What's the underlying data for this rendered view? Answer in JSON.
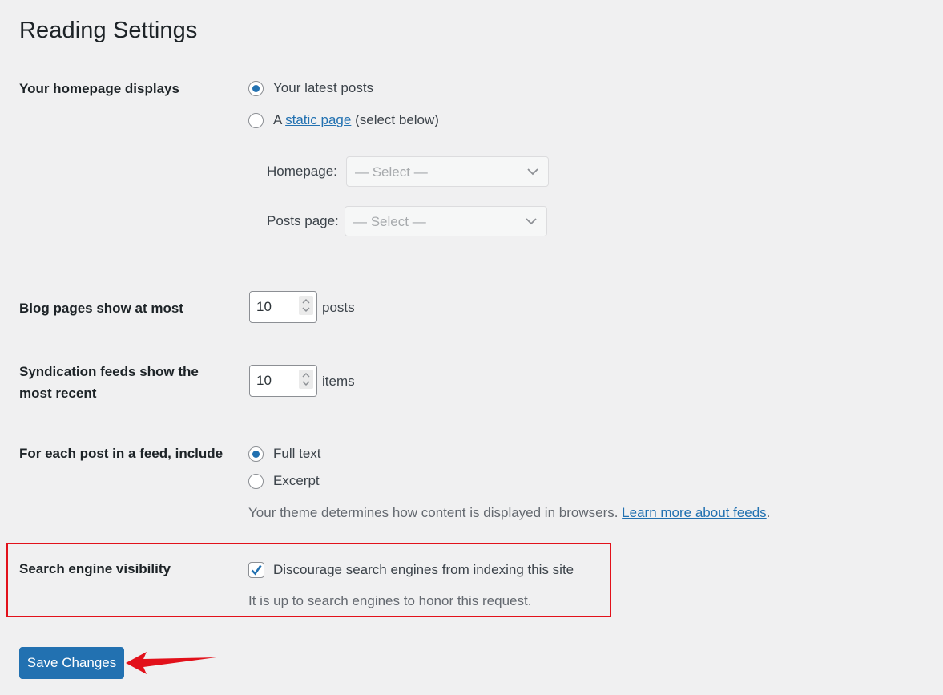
{
  "page": {
    "title": "Reading Settings"
  },
  "homepage_displays": {
    "label": "Your homepage displays",
    "options": [
      {
        "label": "Your latest posts",
        "checked": true
      },
      {
        "prefix": "A ",
        "link": "static page",
        "suffix": " (select below)",
        "checked": false
      }
    ],
    "homepage_select": {
      "label": "Homepage:",
      "placeholder": "— Select —"
    },
    "posts_page_select": {
      "label": "Posts page:",
      "placeholder": "— Select —"
    }
  },
  "blog_pages": {
    "label": "Blog pages show at most",
    "value": "10",
    "unit": "posts"
  },
  "syndication": {
    "label_line1": "Syndication feeds show the",
    "label_line2": "most recent",
    "value": "10",
    "unit": "items"
  },
  "feed_content": {
    "label": "For each post in a feed, include",
    "options": [
      {
        "label": "Full text",
        "checked": true
      },
      {
        "label": "Excerpt",
        "checked": false
      }
    ],
    "description": "Your theme determines how content is displayed in browsers. ",
    "link": "Learn more about feeds",
    "period": "."
  },
  "search_visibility": {
    "label": "Search engine visibility",
    "checkbox_label": "Discourage search engines from indexing this site",
    "checked": true,
    "description": "It is up to search engines to honor this request."
  },
  "actions": {
    "save_label": "Save Changes"
  },
  "colors": {
    "accent": "#2271b1",
    "annotation": "#e2111b",
    "background": "#f0f0f1"
  }
}
